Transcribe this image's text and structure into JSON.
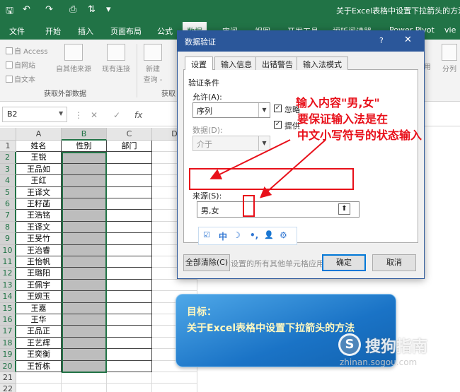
{
  "window": {
    "title": "关于Excel表格中设置下拉箭头的方法.x"
  },
  "ribbon_tabs": [
    "文件",
    "开始",
    "插入",
    "页面布局",
    "公式",
    "数据",
    "审阅",
    "视图",
    "开发工具",
    "福昕阅读器",
    "Power Pivot",
    "vie"
  ],
  "ribbon": {
    "small_items": [
      "自 Access",
      "自网站",
      "自文本"
    ],
    "from_other": "自其他来源",
    "existing_conn": "现有连接",
    "new_query_1": "新建",
    "new_query_2": "查询 -",
    "group_external": "获取外部数据",
    "group_transform": "获取",
    "right_item": "用",
    "split": "分列"
  },
  "formula_bar": {
    "name_box": "B2",
    "fx": "fx"
  },
  "sheet": {
    "columns": [
      "A",
      "B",
      "C",
      "D"
    ],
    "rows": [
      [
        "1",
        "姓名",
        "性别",
        "部门"
      ],
      [
        "2",
        "王锐",
        "",
        ""
      ],
      [
        "3",
        "王品如",
        "",
        ""
      ],
      [
        "4",
        "王红",
        "",
        ""
      ],
      [
        "5",
        "王译文",
        "",
        ""
      ],
      [
        "6",
        "王籽菡",
        "",
        ""
      ],
      [
        "7",
        "王浩铭",
        "",
        ""
      ],
      [
        "8",
        "王译文",
        "",
        ""
      ],
      [
        "9",
        "王旻竹",
        "",
        ""
      ],
      [
        "10",
        "王治睿",
        "",
        ""
      ],
      [
        "11",
        "王怡帆",
        "",
        ""
      ],
      [
        "12",
        "王璐阳",
        "",
        ""
      ],
      [
        "13",
        "王佩宇",
        "",
        ""
      ],
      [
        "14",
        "王婉玉",
        "",
        ""
      ],
      [
        "15",
        "王嘉",
        "",
        ""
      ],
      [
        "16",
        "王华",
        "",
        ""
      ],
      [
        "17",
        "王品正",
        "",
        ""
      ],
      [
        "18",
        "王艺辉",
        "",
        ""
      ],
      [
        "19",
        "王奕衡",
        "",
        ""
      ],
      [
        "20",
        "王哲栋",
        "",
        ""
      ],
      [
        "21",
        "",
        "",
        ""
      ],
      [
        "22",
        "",
        "",
        ""
      ]
    ]
  },
  "dialog": {
    "title": "数据验证",
    "help": "?",
    "close": "✕",
    "tabs": [
      "设置",
      "输入信息",
      "出错警告",
      "输入法模式"
    ],
    "section": "验证条件",
    "allow_label": "允许(A):",
    "allow_value": "序列",
    "ignore_blank": "忽略",
    "provide_dropdown": "提供",
    "data_label": "数据(D):",
    "data_value": "介于",
    "source_label": "来源(S):",
    "source_value": "男,女",
    "apply_all": "对有同样设置的所有其他单元格应用这些更改(P)",
    "clear_all": "全部清除(C)",
    "ok": "确定",
    "cancel": "取消",
    "ime_items": [
      "中",
      "☽",
      "•,",
      "👤",
      "⚙"
    ]
  },
  "annotation": {
    "line1": "输入内容\"男,女\"",
    "line2": "要保证输入法是在",
    "line3": "中文小写符号的状态输入"
  },
  "goal_box": {
    "heading": "目标：",
    "body": "关于Excel表格中设置下拉箭头的方法"
  },
  "watermark": {
    "text": "搜狗指南",
    "url": "zhinan.sogou.com"
  },
  "colors": {
    "excel_green": "#217346",
    "dialog_blue": "#2b579a",
    "annotation_red": "#e8101a",
    "goal_blue": "#1a73c6"
  }
}
